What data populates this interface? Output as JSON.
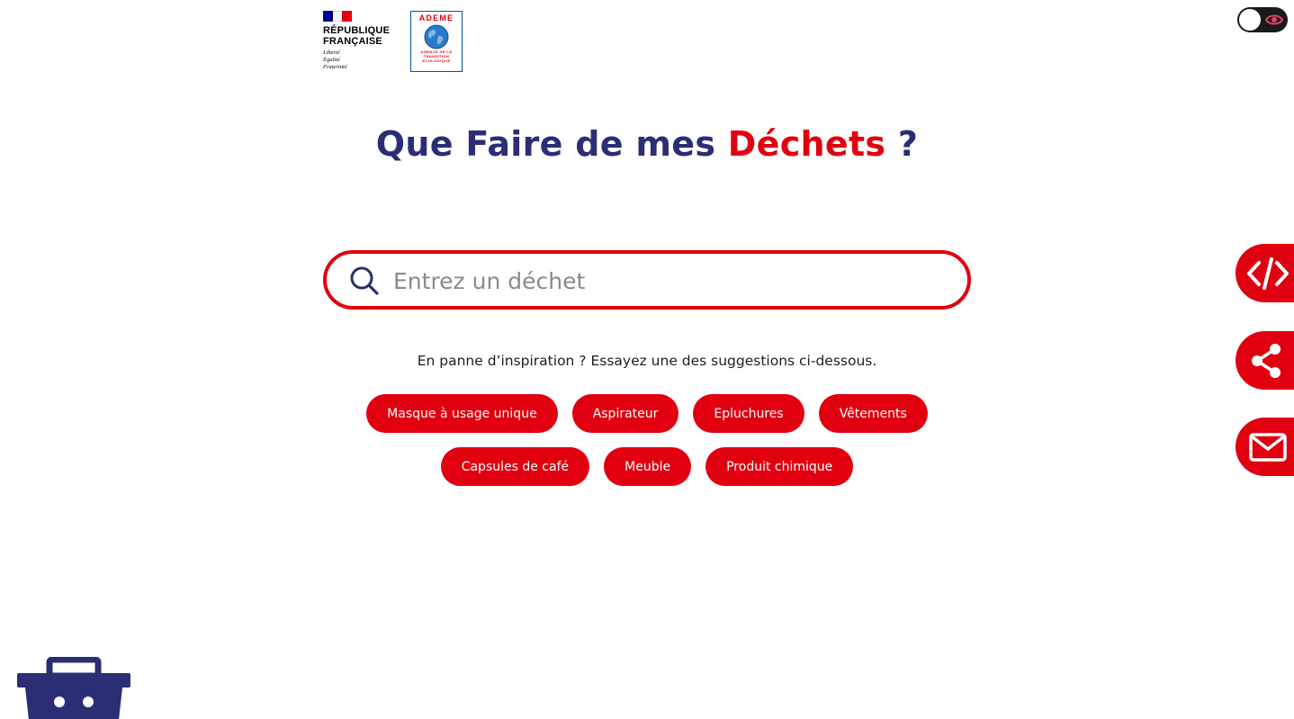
{
  "header": {
    "republique_logo": {
      "title_line1": "RÉPUBLIQUE",
      "title_line2": "FRANÇAISE",
      "motto_line1": "Liberté",
      "motto_line2": "Égalité",
      "motto_line3": "Fraternité",
      "flag_colors": [
        "#000091",
        "#ffffff",
        "#e1000f"
      ]
    },
    "ademe_logo": {
      "name": "ADEME",
      "sub_line1": "AGENCE DE LA",
      "sub_line2": "TRANSITION",
      "sub_line3": "ÉCOLOGIQUE"
    },
    "toggle": {
      "icon": "eye-icon",
      "state": "off"
    }
  },
  "main": {
    "title_prefix": "Que Faire de mes ",
    "title_accent": "Déchets",
    "title_suffix": " ?",
    "search": {
      "placeholder": "Entrez un déchet",
      "value": "",
      "icon": "search-icon"
    },
    "hint": "En panne d’inspiration ? Essayez une des suggestions ci-dessous.",
    "suggestions_row1": [
      "Masque à usage unique",
      "Aspirateur",
      "Epluchures",
      "Vêtements"
    ],
    "suggestions_row2": [
      "Capsules de café",
      "Meuble",
      "Produit chimique"
    ]
  },
  "side_tabs": [
    {
      "icon": "code-icon"
    },
    {
      "icon": "share-icon"
    },
    {
      "icon": "mail-icon"
    }
  ],
  "colors": {
    "brand_blue": "#2b2e74",
    "brand_red": "#e1000f",
    "text": "#1e1e1e",
    "placeholder": "#8a8a8a"
  }
}
